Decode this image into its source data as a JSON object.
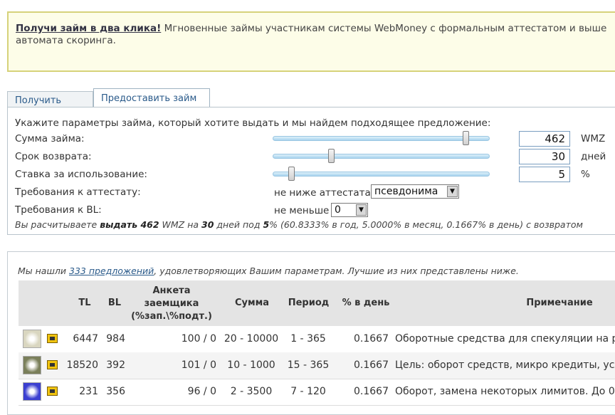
{
  "banner": {
    "link": "Получи займ в два клика!",
    "text": " Мгновенные займы участникам системы WebMoney с формальным аттестатом и выше",
    "line2": "автомата скоринга."
  },
  "tabs": [
    {
      "label": "Получить займ",
      "active": false
    },
    {
      "label": "Предоставить займ",
      "active": true
    }
  ],
  "form": {
    "intro": "Укажите параметры займа, который хотите выдать и мы найдем подходящее предложение:",
    "amount": {
      "label": "Сумма займа:",
      "value": "462",
      "unit": "WMZ",
      "slider_fraction": 0.9
    },
    "term": {
      "label": "Срок возврата:",
      "value": "30",
      "unit": "дней",
      "slider_fraction": 0.26
    },
    "rate": {
      "label": "Ставка за использование:",
      "value": "5",
      "unit": "%",
      "slider_fraction": 0.07
    },
    "attestat": {
      "label": "Требования к аттестату:",
      "caption": "не ниже аттестата",
      "selected": "псевдонима"
    },
    "bl": {
      "label": "Требования к BL:",
      "caption": "не меньше",
      "selected": "0"
    },
    "summary": {
      "p1": "Вы расчитываете ",
      "b1": "выдать 462",
      "p2": " WMZ на ",
      "b2": "30",
      "p3": " дней под ",
      "b3": "5",
      "p4": "% (60.8333% в год, 5.0000% в месяц, 0.1667% в день) с возвратом"
    }
  },
  "results": {
    "found_pre": "Мы нашли ",
    "found_link": "333 предложений",
    "found_post": ", удовлетворяющих Вашим параметрам. Лучшие из них представлены ниже.",
    "headers": {
      "tl": "TL",
      "bl": "BL",
      "anketa1": "Анкета",
      "anketa2": "заемщика",
      "anketa3": "(%зап.\\%подт.)",
      "sum": "Сумма",
      "period": "Период",
      "pct": "% в день",
      "note": "Примечание"
    },
    "rows": [
      {
        "tl": "6447",
        "bl": "984",
        "anketa": "100 / 0",
        "sum": "20 - 10000",
        "period": "1 - 365",
        "pct": "0.1667",
        "note": "Оборотные средства для спекуляции на р",
        "avatar_color": "#d9d6c0"
      },
      {
        "tl": "18520",
        "bl": "392",
        "anketa": "101 / 0",
        "sum": "10 - 1000",
        "period": "15 - 365",
        "pct": "0.1667",
        "note": "Цель: оборот средств, микро кредиты, усл",
        "avatar_color": "#7a7f5a"
      },
      {
        "tl": "231",
        "bl": "356",
        "anketa": "96 / 0",
        "sum": "2 - 3500",
        "period": "7 - 120",
        "pct": "0.1667",
        "note": "Оборот, замена некоторых лимитов. До 0.",
        "avatar_color": "#3b3fd1"
      }
    ]
  }
}
